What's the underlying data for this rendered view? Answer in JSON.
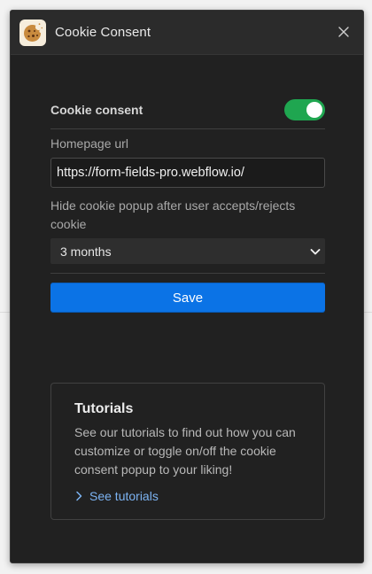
{
  "window": {
    "title": "Cookie Consent",
    "app_icon": "cookie-icon",
    "close_icon": "close-icon"
  },
  "settings": {
    "consent_label": "Cookie consent",
    "consent_enabled": true,
    "homepage_label": "Homepage url",
    "homepage_value": "https://form-fields-pro.webflow.io/",
    "hide_label": "Hide cookie popup after user accepts/rejects cookie",
    "hide_selected": "3 months",
    "save_label": "Save"
  },
  "tutorials": {
    "title": "Tutorials",
    "description": "See our tutorials to find out how you can customize or toggle on/off the cookie consent popup to your liking!",
    "link_label": "See tutorials"
  },
  "colors": {
    "panel_bg": "#212121",
    "toggle_on": "#1fa650",
    "primary_button": "#0b73e6",
    "link": "#7cb3f2"
  }
}
